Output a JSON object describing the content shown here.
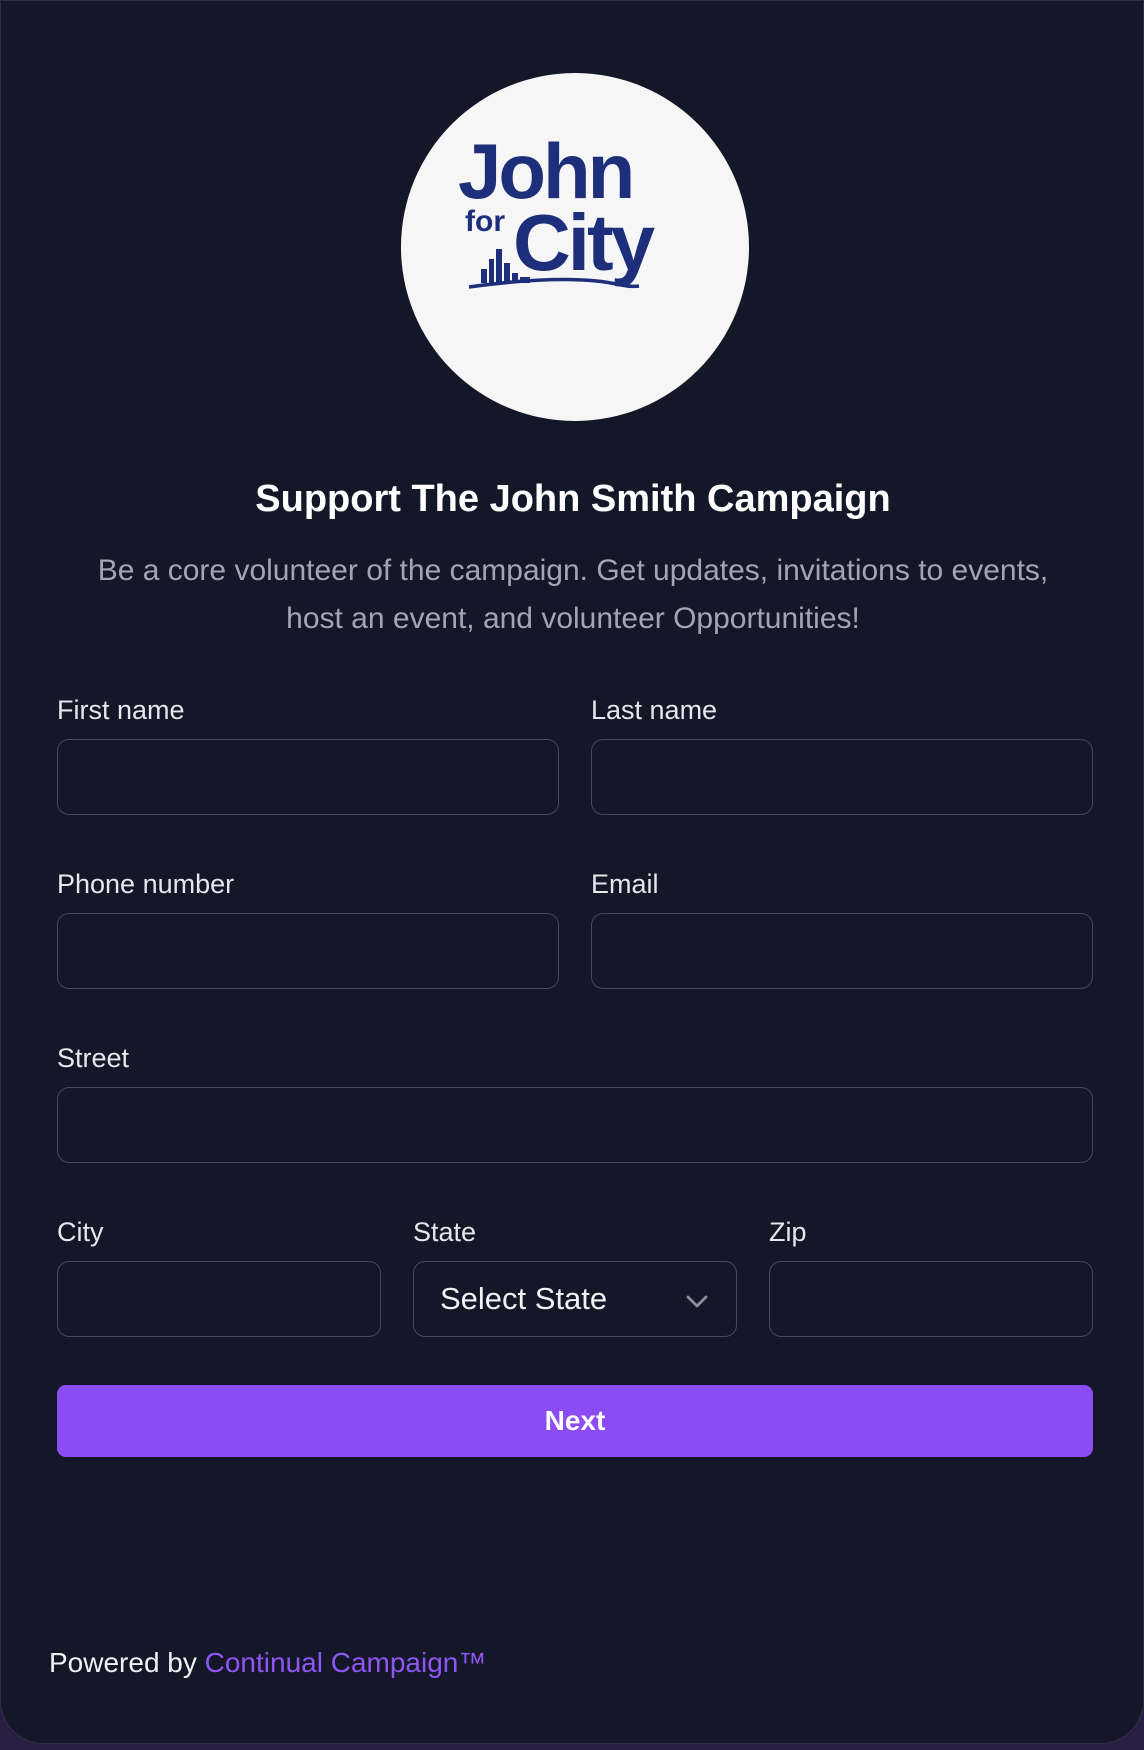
{
  "logo": {
    "line1": "John",
    "line2_small": "for",
    "line2_big": "City",
    "brand_color": "#1d2f7a",
    "icon": "city-skyline-icon"
  },
  "heading": "Support The John Smith Campaign",
  "subtitle": {
    "line1": "Be a core volunteer of the campaign. Get updates, invitations to events,",
    "line2": "host an event, and volunteer Opportunities!"
  },
  "form": {
    "first_name_label": "First name",
    "first_name_value": "",
    "last_name_label": "Last name",
    "last_name_value": "",
    "phone_label": "Phone number",
    "phone_value": "",
    "email_label": "Email",
    "email_value": "",
    "street_label": "Street",
    "street_value": "",
    "city_label": "City",
    "city_value": "",
    "state_label": "State",
    "state_selected": "Select State",
    "zip_label": "Zip",
    "zip_value": "",
    "next_label": "Next"
  },
  "footer": {
    "prefix": "Powered by ",
    "link_text": "Continual Campaign™"
  },
  "colors": {
    "background": "#131727",
    "accent": "#8b4cf5",
    "input_border": "#454a5a",
    "muted_text": "#a3a6b2"
  }
}
